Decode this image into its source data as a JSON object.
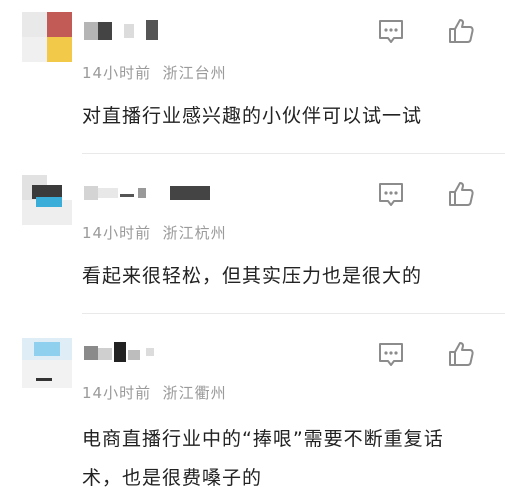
{
  "comments": [
    {
      "time": "14小时前",
      "location": "浙江台州",
      "text": "对直播行业感兴趣的小伙伴可以试一试"
    },
    {
      "time": "14小时前",
      "location": "浙江杭州",
      "text": "看起来很轻松，但其实压力也是很大的"
    },
    {
      "time": "14小时前",
      "location": "浙江衢州",
      "text": "电商直播行业中的“捧哏”需要不断重复话术，也是很费嗓子的"
    }
  ],
  "icons": {
    "reply": "comment-bubble-icon",
    "like": "thumbs-up-icon"
  },
  "colors": {
    "text": "#222222",
    "meta": "#9a9a9a",
    "icon": "#8c8c8c",
    "divider": "#e9e9e9"
  }
}
